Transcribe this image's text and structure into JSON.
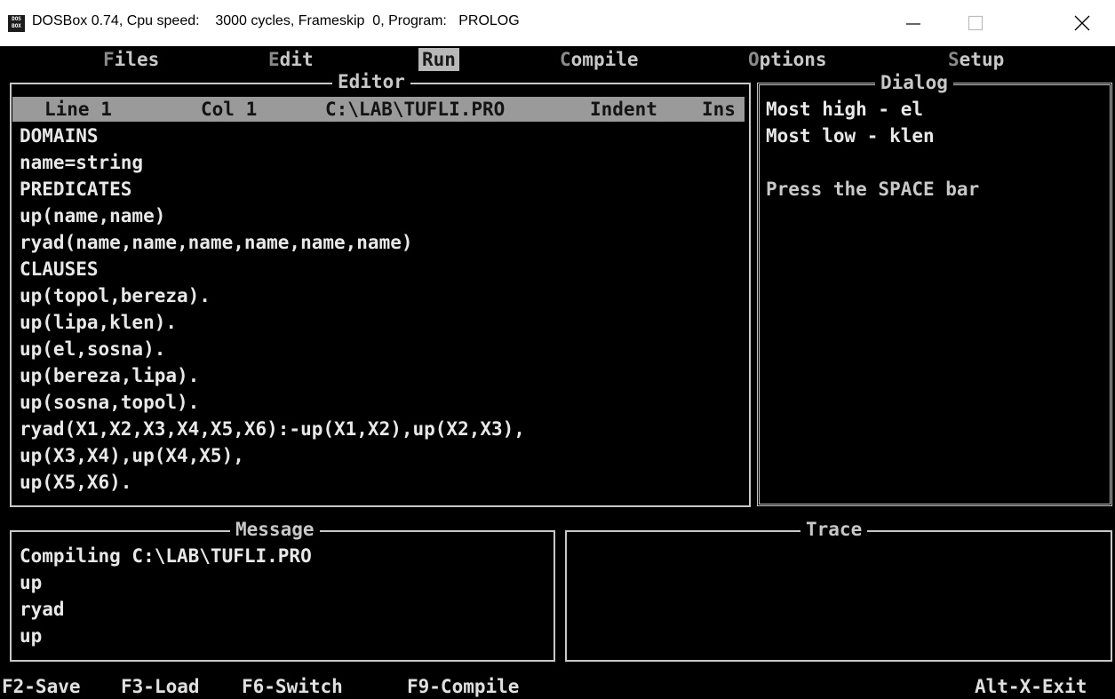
{
  "window": {
    "icon_text": "DOS BOX",
    "title": "DOSBox 0.74, Cpu speed:    3000 cycles, Frameskip  0, Program:   PROLOG",
    "minimize_icon": "minimize-icon",
    "maximize_icon": "maximize-icon",
    "close_icon": "close-icon"
  },
  "menu": {
    "items": [
      {
        "hot": "F",
        "rest": "iles"
      },
      {
        "hot": "E",
        "rest": "dit"
      },
      {
        "hot": "",
        "rest": "Run"
      },
      {
        "hot": "C",
        "rest": "ompile"
      },
      {
        "hot": "O",
        "rest": "ptions"
      },
      {
        "hot": "S",
        "rest": "etup"
      }
    ]
  },
  "editor": {
    "title": "Editor",
    "status": {
      "line": "Line 1",
      "col": "Col 1",
      "file": "C:\\LAB\\TUFLI.PRO",
      "indent": "Indent",
      "ins": "Ins"
    },
    "lines": [
      "DOMAINS",
      "name=string",
      "PREDICATES",
      "up(name,name)",
      "ryad(name,name,name,name,name,name)",
      "CLAUSES",
      "up(topol,bereza).",
      "up(lipa,klen).",
      "up(el,sosna).",
      "up(bereza,lipa).",
      "up(sosna,topol).",
      "ryad(X1,X2,X3,X4,X5,X6):-up(X1,X2),up(X2,X3),",
      "up(X3,X4),up(X4,X5),",
      "up(X5,X6)."
    ]
  },
  "dialog": {
    "title": "Dialog",
    "lines": [
      "Most high - el",
      "Most low - klen",
      "",
      "Press the SPACE bar"
    ]
  },
  "message": {
    "title": "Message",
    "lines": [
      "Compiling C:\\LAB\\TUFLI.PRO",
      "up",
      "ryad",
      "up"
    ]
  },
  "trace": {
    "title": "Trace"
  },
  "function_keys": {
    "save": "F2-Save",
    "load": "F3-Load",
    "switch": "F6-Switch",
    "compile": "F9-Compile",
    "exit": "Alt-X-Exit"
  }
}
